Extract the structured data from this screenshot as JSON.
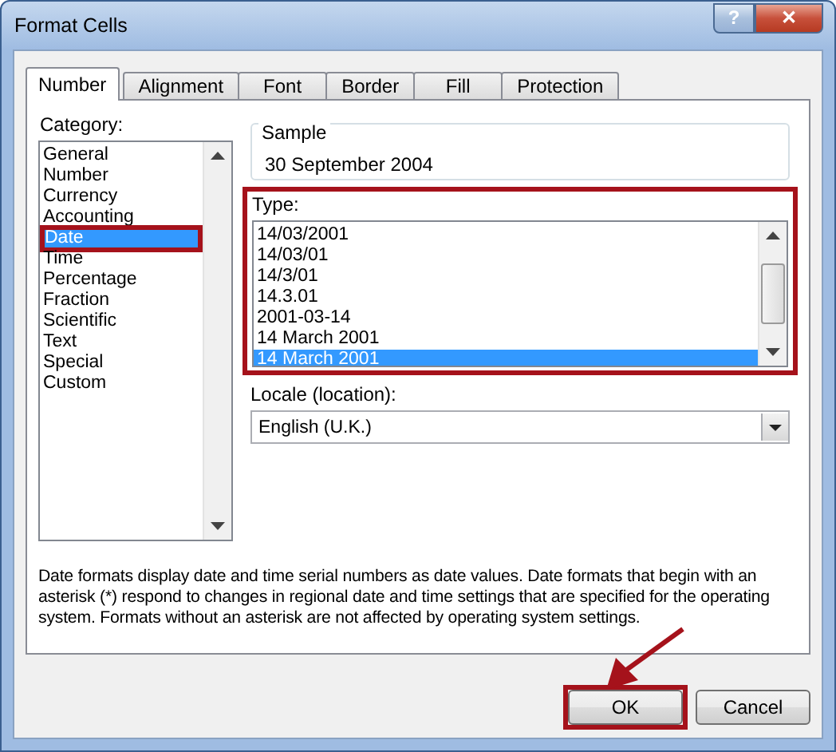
{
  "window": {
    "title": "Format Cells",
    "buttons": [
      "?",
      "✕"
    ]
  },
  "tabs": [
    {
      "label": "Number",
      "selected": true
    },
    {
      "label": "Alignment",
      "selected": false
    },
    {
      "label": "Font",
      "selected": false
    },
    {
      "label": "Border",
      "selected": false
    },
    {
      "label": "Fill",
      "selected": false
    },
    {
      "label": "Protection",
      "selected": false
    }
  ],
  "category": {
    "label": "Category:",
    "items": [
      {
        "label": "General",
        "selected": false,
        "highlighted": false
      },
      {
        "label": "Number",
        "selected": false,
        "highlighted": false
      },
      {
        "label": "Currency",
        "selected": false,
        "highlighted": false
      },
      {
        "label": "Accounting",
        "selected": false,
        "highlighted": false
      },
      {
        "label": "Date",
        "selected": true,
        "highlighted": true
      },
      {
        "label": "Time",
        "selected": false,
        "highlighted": false
      },
      {
        "label": "Percentage",
        "selected": false,
        "highlighted": false
      },
      {
        "label": "Fraction",
        "selected": false,
        "highlighted": false
      },
      {
        "label": "Scientific",
        "selected": false,
        "highlighted": false
      },
      {
        "label": "Text",
        "selected": false,
        "highlighted": false
      },
      {
        "label": "Special",
        "selected": false,
        "highlighted": false
      },
      {
        "label": "Custom",
        "selected": false,
        "highlighted": false
      }
    ]
  },
  "sample": {
    "label": "Sample",
    "value": "30 September 2004"
  },
  "type": {
    "label": "Type:",
    "highlighted": true,
    "items": [
      {
        "label": "14/03/2001",
        "selected": false
      },
      {
        "label": "14/03/01",
        "selected": false
      },
      {
        "label": "14/3/01",
        "selected": false
      },
      {
        "label": "14.3.01",
        "selected": false
      },
      {
        "label": "2001-03-14",
        "selected": false
      },
      {
        "label": "14 March 2001",
        "selected": false
      },
      {
        "label": "14 March 2001",
        "selected": true
      }
    ]
  },
  "locale": {
    "label": "Locale (location):",
    "value": "English (U.K.)"
  },
  "description": "Date formats display date and time serial numbers as date values.  Date formats that begin with an asterisk (*) respond to changes in regional date and time settings that are specified for the operating system. Formats without an asterisk are not affected by operating system settings.",
  "buttons": [
    {
      "label": "OK",
      "highlighted": true,
      "pointed": true
    },
    {
      "label": "Cancel",
      "highlighted": false,
      "pointed": false
    }
  ]
}
